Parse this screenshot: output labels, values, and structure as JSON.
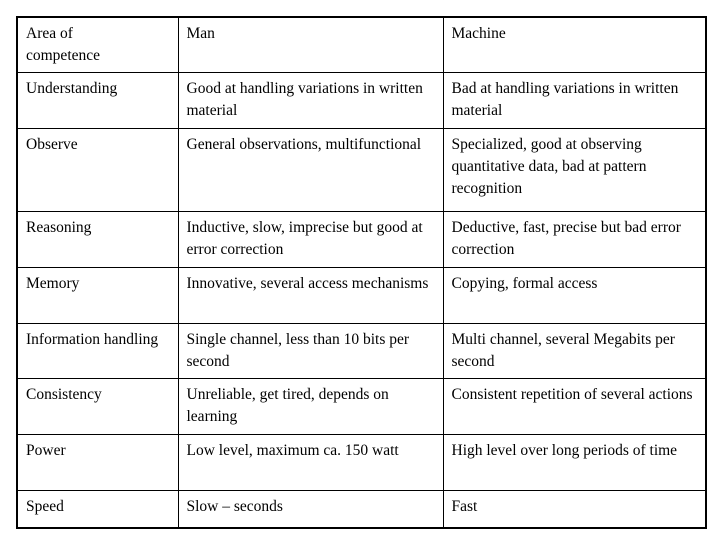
{
  "table": {
    "name": "man-vs-machine-competence-table",
    "columns": [
      "Area of\ncompetence",
      "Man",
      "Machine"
    ],
    "rows": [
      {
        "area": "Understanding",
        "man": "Good at handling variations in written material",
        "machine": "Bad at handling variations in written material"
      },
      {
        "area": "Observe",
        "man": "General observations, multifunctional",
        "machine": "Specialized, good at observing quantitative data, bad at pattern recognition"
      },
      {
        "area": "Reasoning",
        "man": "Inductive, slow, imprecise but good at error correction",
        "machine": "Deductive, fast, precise but bad error correction"
      },
      {
        "area": "Memory",
        "man": "Innovative, several access mechanisms",
        "machine": "Copying, formal access"
      },
      {
        "area": "Information handling",
        "man": "Single channel, less than 10 bits per second",
        "machine": "Multi channel, several Megabits per second"
      },
      {
        "area": "Consistency",
        "man": "Unreliable, get tired, depends on learning",
        "machine": "Consistent repetition of several actions"
      },
      {
        "area": "Power",
        "man": "Low level, maximum ca. 150 watt",
        "machine": "High level over long periods of time"
      },
      {
        "area": "Speed",
        "man": "Slow – seconds",
        "machine": "Fast"
      }
    ]
  },
  "colors": {
    "background": "#ffffff",
    "border": "#000000",
    "text": "#000000"
  }
}
